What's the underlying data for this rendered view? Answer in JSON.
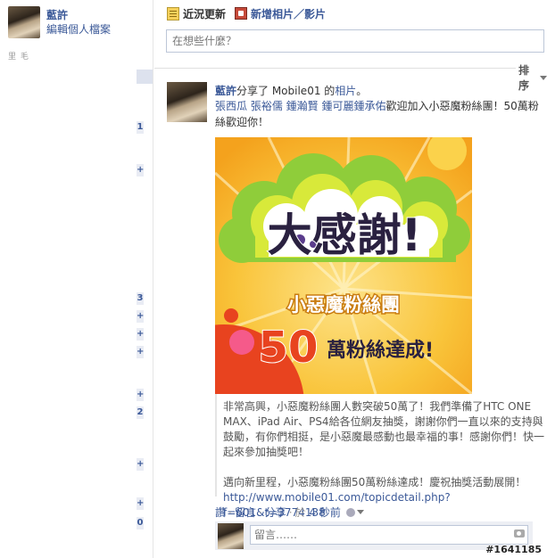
{
  "profile": {
    "name": "藍許",
    "edit_label": "編輯個人檔案",
    "stub": "里 毛"
  },
  "gutter_marks": [
    "1",
    "+",
    "3",
    "+",
    "+",
    "+",
    "+",
    "2",
    "+",
    "+",
    "0"
  ],
  "composer": {
    "tab_status": "近況更新",
    "tab_photo": "新增相片／影片",
    "placeholder": "在想些什麼？"
  },
  "feed": {
    "sort_label": "排序"
  },
  "story": {
    "author": "藍許",
    "action": "分享了 Mobile01 的",
    "object": "相片",
    "end": "。",
    "tags": "張西瓜 張裕儒 鍾瀚賢 鍾可麗鍾承佑",
    "message": "歡迎加入小惡魔粉絲團！50萬粉絲歡迎你！",
    "image": {
      "line1": "大感謝!",
      "line2": "小惡魔粉絲團",
      "num": "50",
      "line3": "萬粉絲達成!"
    },
    "caption_p1": "非常高興，小惡魔粉絲團人數突破50萬了！我們準備了HTC ONE MAX、iPad Air、PS4給各位網友抽獎，謝謝你們一直以來的支持與鼓勵，有你們相挺，是小惡魔最感動也最幸福的事！感謝你們！快一起來參加抽獎吧！",
    "caption_p2": "邁向新里程，小惡魔粉絲團50萬粉絲達成！慶祝抽獎活動展開！",
    "caption_url": "http://www.mobile01.com/topicdetail.php?f=601&t=3774138",
    "actions": {
      "like": "讚",
      "comment": "留言",
      "share": "分享",
      "time_prefix": "於",
      "time": "4 秒前"
    },
    "comment_placeholder": "留言……"
  },
  "watermark": "#1641185",
  "colors": {
    "link": "#3b5998",
    "image_bg": "#f7b125",
    "image_red": "#e8431f"
  }
}
